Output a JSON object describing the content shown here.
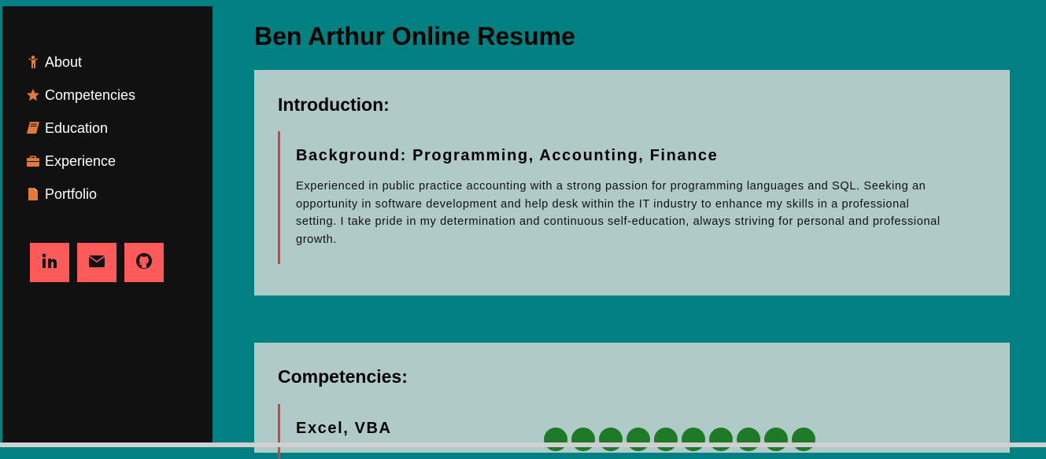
{
  "sidebar": {
    "nav": [
      {
        "label": "About",
        "icon": "person-icon"
      },
      {
        "label": "Competencies",
        "icon": "star-icon"
      },
      {
        "label": "Education",
        "icon": "book-icon"
      },
      {
        "label": "Experience",
        "icon": "briefcase-icon"
      },
      {
        "label": "Portfolio",
        "icon": "file-icon"
      }
    ],
    "social": [
      "linkedin-icon",
      "envelope-icon",
      "github-icon"
    ]
  },
  "main": {
    "title": "Ben Arthur Online Resume",
    "intro": {
      "heading": "Introduction:",
      "subheading": "Background: Programming, Accounting, Finance",
      "body": "Experienced in public practice accounting with a strong passion for programming languages and SQL. Seeking an opportunity in software development and help desk within the IT industry to enhance my skills in a professional setting. I take pride in my determination and continuous self-education, always striving for personal and professional growth."
    },
    "competencies": {
      "heading": "Competencies:",
      "skills": [
        {
          "name": "Excel, VBA",
          "level": 10,
          "max": 10
        }
      ]
    }
  },
  "colors": {
    "background": "#008080",
    "sidebar": "#111111",
    "icon": "#e07a3a",
    "social_button": "#ff5a5a",
    "card": "#b0c9c9",
    "accent_border": "#e03c3c",
    "dot": "#1f7a28"
  }
}
